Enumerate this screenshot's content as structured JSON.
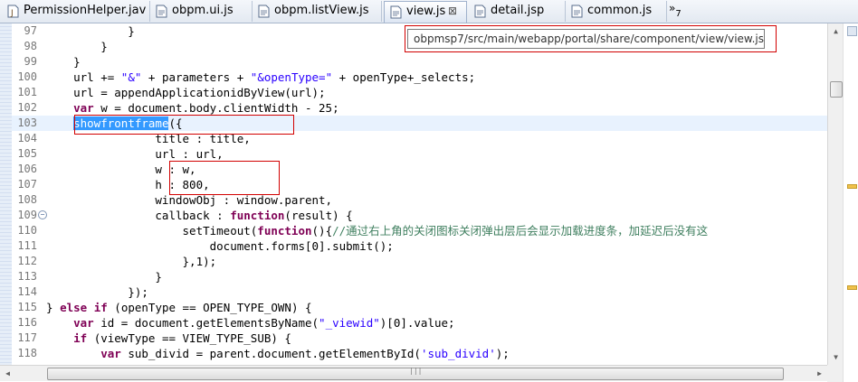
{
  "tabs": [
    {
      "label": "PermissionHelper.jav",
      "icon": "java-file-icon",
      "active": false
    },
    {
      "label": "obpm.ui.js",
      "icon": "js-file-icon",
      "active": false
    },
    {
      "label": "obpm.listView.js",
      "icon": "js-file-icon",
      "active": false
    },
    {
      "label": "view.js",
      "icon": "js-file-icon",
      "active": true,
      "close": "⊠"
    },
    {
      "label": "detail.jsp",
      "icon": "jsp-file-icon",
      "active": false
    },
    {
      "label": "common.js",
      "icon": "js-file-icon",
      "active": false
    }
  ],
  "overflow": {
    "symbol": "»",
    "count": "7"
  },
  "tooltip": {
    "path": "obpmsp7/src/main/webapp/portal/share/component/view/view.js"
  },
  "editor": {
    "current_line": "103",
    "lines": [
      {
        "num": "97",
        "code": "            }"
      },
      {
        "num": "98",
        "code": "        }"
      },
      {
        "num": "99",
        "code": "    }"
      },
      {
        "num": "100",
        "code": "    url += \"&\" + parameters + \"&openType=\" + openType+_selects;"
      },
      {
        "num": "101",
        "code": "    url = appendApplicationidByView(url);"
      },
      {
        "num": "102",
        "code": "    var w = document.body.clientWidth - 25;"
      },
      {
        "num": "103",
        "code": "    showfrontframe({"
      },
      {
        "num": "104",
        "code": "                title : title,"
      },
      {
        "num": "105",
        "code": "                url : url,"
      },
      {
        "num": "106",
        "code": "                w : w,"
      },
      {
        "num": "107",
        "code": "                h : 800,"
      },
      {
        "num": "108",
        "code": "                windowObj : window.parent,"
      },
      {
        "num": "109",
        "code": "                callback : function(result) {"
      },
      {
        "num": "110",
        "code": "                    setTimeout(function(){//通过右上角的关闭图标关闭弹出层后会显示加载进度条，加延迟后没有这"
      },
      {
        "num": "111",
        "code": "                        document.forms[0].submit();"
      },
      {
        "num": "112",
        "code": "                    },1);"
      },
      {
        "num": "113",
        "code": "                }"
      },
      {
        "num": "114",
        "code": "            });"
      },
      {
        "num": "115",
        "code": "} else if (openType == OPEN_TYPE_OWN) {"
      },
      {
        "num": "116",
        "code": "    var id = document.getElementsByName(\"_viewid\")[0].value;"
      },
      {
        "num": "117",
        "code": "    if (viewType == VIEW_TYPE_SUB) {"
      },
      {
        "num": "118",
        "code": "        var sub_divid = parent.document.getElementById('sub_divid');"
      }
    ]
  },
  "scroll": {
    "up": "▲",
    "down": "▼",
    "left": "◀",
    "right": "▶",
    "grip": "|||"
  },
  "colors": {
    "keyword": "#7f0055",
    "string": "#2a00ff",
    "comment": "#3f7f5f",
    "selection": "#3399ff",
    "annotation": "#d20000"
  }
}
